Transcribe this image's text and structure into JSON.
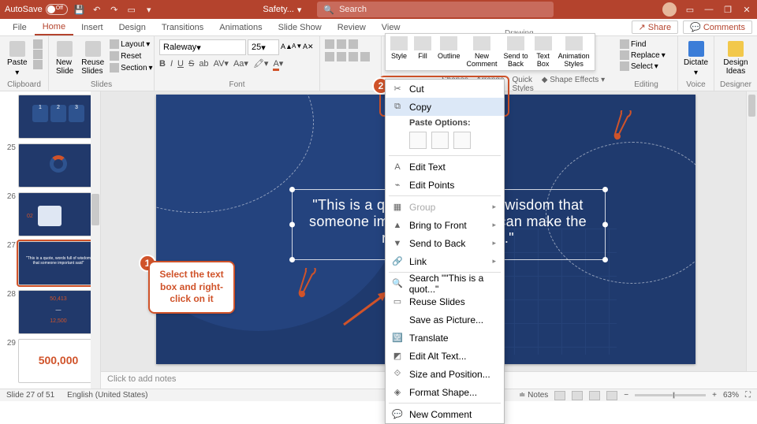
{
  "titlebar": {
    "autosave_label": "AutoSave",
    "autosave_state": "Off",
    "doc_title": "Safety...",
    "search_placeholder": "Search"
  },
  "tabs": {
    "items": [
      "File",
      "Home",
      "Insert",
      "Design",
      "Transitions",
      "Animations",
      "Slide Show",
      "Review",
      "View"
    ],
    "active_index": 1,
    "share": "Share",
    "comments": "Comments"
  },
  "ribbon": {
    "clipboard": {
      "label": "Clipboard",
      "paste": "Paste"
    },
    "slides": {
      "label": "Slides",
      "new_slide": "New\nSlide",
      "reuse": "Reuse\nSlides",
      "layout": "Layout",
      "reset": "Reset",
      "section": "Section"
    },
    "font": {
      "label": "Font",
      "family": "Raleway",
      "size": "25"
    },
    "paragraph_label": "",
    "float": {
      "style": "Style",
      "fill": "Fill",
      "outline": "Outline",
      "newcomment": "New\nComment",
      "sendback": "Send to\nBack",
      "textbox": "Text\nBox",
      "anim": "Animation\nStyles"
    },
    "shapes_arrange": {
      "shapes": "Shapes",
      "arrange": "Arrange",
      "quick": "Quick\nStyles",
      "shape_effects": "Shape Effects"
    },
    "drawing_label": "Drawing",
    "editing": {
      "label": "Editing",
      "find": "Find",
      "replace": "Replace",
      "select": "Select"
    },
    "voice": {
      "label": "Voice",
      "dictate": "Dictate"
    },
    "designer": {
      "label": "Designer",
      "ideas": "Design\nIdeas"
    }
  },
  "thumbs": {
    "numbers": [
      "25",
      "26",
      "27",
      "28",
      "29"
    ],
    "top_nums": [
      "1",
      "2",
      "3"
    ],
    "quote_preview": "\"This is a quote, words full of wisdom that someone important said\"",
    "stats": [
      "50,413",
      "—",
      "12,500"
    ],
    "bignum": "500,000"
  },
  "slide": {
    "quote": "\"This is a quote, words full of wisdom that someone important said and can make the reader get inspired.\""
  },
  "context_menu": {
    "cut": "Cut",
    "copy": "Copy",
    "paste_options": "Paste Options:",
    "edit_text": "Edit Text",
    "edit_points": "Edit Points",
    "group": "Group",
    "bring_front": "Bring to Front",
    "send_back": "Send to Back",
    "link": "Link",
    "search": "Search \"\"This is a quot...\"",
    "reuse": "Reuse Slides",
    "save_pic": "Save as Picture...",
    "translate": "Translate",
    "alt_text": "Edit Alt Text...",
    "size_pos": "Size and Position...",
    "format_shape": "Format Shape...",
    "new_comment": "New Comment"
  },
  "callouts": {
    "one": "Select the text box and right-click on it",
    "badge1": "1",
    "badge2": "2"
  },
  "notes_placeholder": "Click to add notes",
  "status": {
    "slide": "Slide 27 of 51",
    "lang": "English (United States)",
    "notes": "Notes",
    "zoom": "63%"
  }
}
